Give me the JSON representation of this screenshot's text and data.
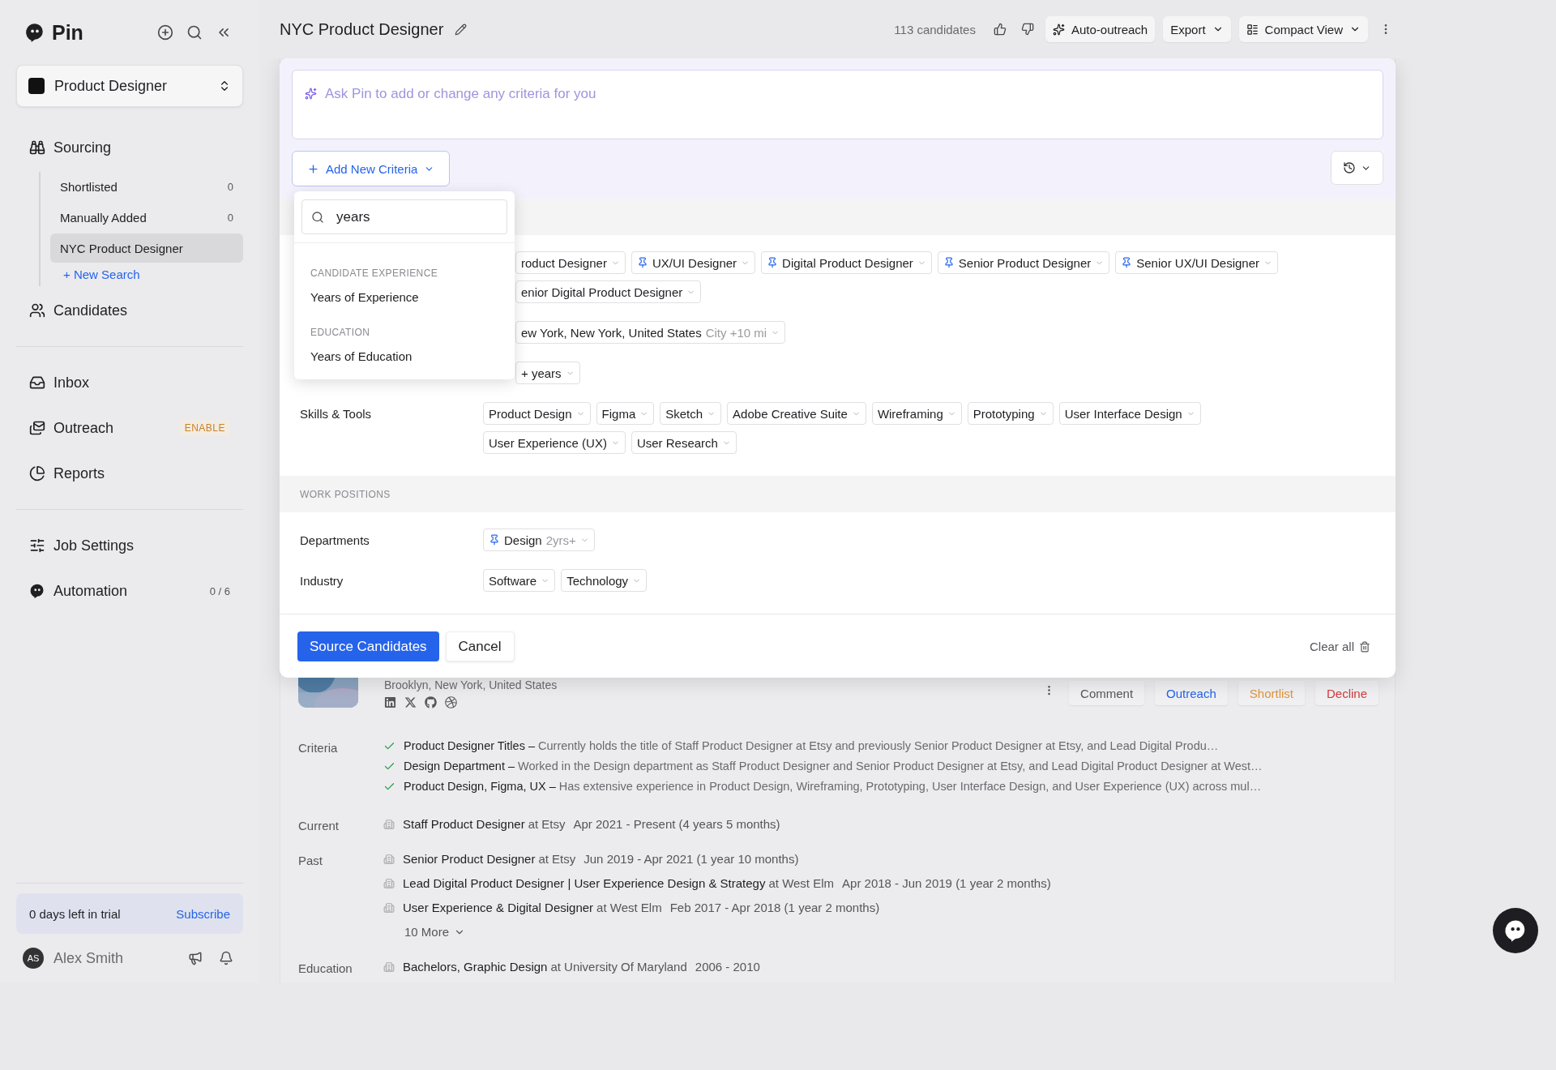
{
  "sidebar": {
    "brand": "Pin",
    "job_selector": "Product Designer",
    "groups": [
      {
        "items": [
          {
            "label": "Sourcing",
            "children": [
              {
                "label": "Shortlisted",
                "count": "0",
                "selected": false
              },
              {
                "label": "Manually Added",
                "count": "0",
                "selected": false
              },
              {
                "label": "NYC Product Designer",
                "selected": true
              }
            ],
            "new_search": "+ New Search"
          },
          {
            "label": "Candidates"
          }
        ]
      },
      {
        "items": [
          {
            "label": "Inbox"
          },
          {
            "label": "Outreach",
            "badge": "ENABLE"
          },
          {
            "label": "Reports"
          }
        ]
      },
      {
        "items": [
          {
            "label": "Job Settings"
          },
          {
            "label": "Automation",
            "count": "0 / 6"
          }
        ]
      }
    ],
    "trial": {
      "text": "0 days left in trial",
      "link": "Subscribe"
    },
    "user": {
      "initials": "AS",
      "name": "Alex Smith"
    }
  },
  "header": {
    "title": "NYC Product Designer",
    "count": "113 candidates",
    "buttons": [
      {
        "label": "Auto-outreach",
        "kind": "sparkle"
      },
      {
        "label": "Export",
        "kind": "menu"
      },
      {
        "label": "Compact View",
        "kind": "view"
      }
    ]
  },
  "criteria_panel": {
    "prompt_placeholder": "Ask Pin to add or change any criteria for you",
    "add_button": "Add New Criteria",
    "dropdown": {
      "search_value": "years",
      "groups": [
        {
          "heading": "CANDIDATE EXPERIENCE",
          "options": [
            "Years of Experience"
          ]
        },
        {
          "heading": "EDUCATION",
          "options": [
            "Years of Education"
          ]
        }
      ]
    },
    "sections": [
      {
        "rows": [
          {
            "chips": [
              {
                "text": "roduct Designer",
                "pinned": false
              },
              {
                "text": "UX/UI Designer",
                "pinned": true
              },
              {
                "text": "Digital Product Designer",
                "pinned": true
              },
              {
                "text": "Senior Product Designer",
                "pinned": true
              },
              {
                "text": "Senior UX/UI Designer",
                "pinned": true
              },
              {
                "text": "enior Digital Product Designer",
                "pinned": false
              }
            ]
          },
          {
            "chips": [
              {
                "text": "ew York, New York, United States",
                "suffix": "City +10 mi",
                "pinned": false
              }
            ]
          },
          {
            "chips": [
              {
                "text": "+ years",
                "pinned": false
              }
            ]
          },
          {
            "label": "Skills & Tools",
            "chips": [
              {
                "text": "Product Design",
                "pinned": false
              },
              {
                "text": "Figma",
                "pinned": false
              },
              {
                "text": "Sketch",
                "pinned": false
              },
              {
                "text": "Adobe Creative Suite",
                "pinned": false
              },
              {
                "text": "Wireframing",
                "pinned": false
              },
              {
                "text": "Prototyping",
                "pinned": false
              },
              {
                "text": "User Interface Design",
                "pinned": false
              },
              {
                "text": "User Experience (UX)",
                "pinned": false
              },
              {
                "text": "User Research",
                "pinned": false
              }
            ]
          }
        ]
      },
      {
        "heading": "WORK POSITIONS",
        "rows": [
          {
            "label": "Departments",
            "chips": [
              {
                "text": "Design",
                "suffix": "2yrs+",
                "pinned": true
              }
            ]
          },
          {
            "label": "Industry",
            "chips": [
              {
                "text": "Software",
                "pinned": false
              },
              {
                "text": "Technology",
                "pinned": false
              }
            ]
          }
        ]
      }
    ],
    "submit": "Source Candidates",
    "cancel": "Cancel",
    "clear": "Clear all"
  },
  "candidate": {
    "location": "Brooklyn, New York, United States",
    "actions": [
      {
        "label": "Comment",
        "color": "#55555c"
      },
      {
        "label": "Outreach",
        "color": "#2563eb"
      },
      {
        "label": "Shortlist",
        "color": "#e0953a"
      },
      {
        "label": "Decline",
        "color": "#d23a3a"
      }
    ],
    "criteria_label": "Criteria",
    "criteria": [
      "**Product Designer Titles –** Currently holds the title of Staff Product Designer at Etsy and previously Senior Product Designer at Etsy, and Lead Digital Produ…",
      "**Design Department –** Worked in the Design department as Staff Product Designer and Senior Product Designer at Etsy, and Lead Digital Product Designer at West…",
      "**Product Design, Figma, UX –** Has extensive experience in Product Design, Wireframing, Prototyping, User Interface Design, and User Experience (UX) across mul…"
    ],
    "current_label": "Current",
    "current": [
      {
        "title": "Staff Product Designer",
        "company": "at Etsy",
        "dates": "Apr 2021 - Present (4 years 5 months)"
      }
    ],
    "past_label": "Past",
    "past": [
      {
        "title": "Senior Product Designer",
        "company": "at Etsy",
        "dates": "Jun 2019 - Apr 2021 (1 year 10 months)"
      },
      {
        "title": "Lead Digital Product Designer | User Experience Design & Strategy",
        "company": "at West Elm",
        "dates": "Apr 2018 - Jun 2019 (1 year 2 months)"
      },
      {
        "title": "User Experience & Digital Designer",
        "company": "at West Elm",
        "dates": "Feb 2017 - Apr 2018 (1 year 2 months)"
      }
    ],
    "more": "10 More",
    "education_label": "Education",
    "education": [
      {
        "title": "Bachelors, Graphic Design",
        "company": "at University Of Maryland",
        "dates": "2006 - 2010"
      }
    ]
  }
}
